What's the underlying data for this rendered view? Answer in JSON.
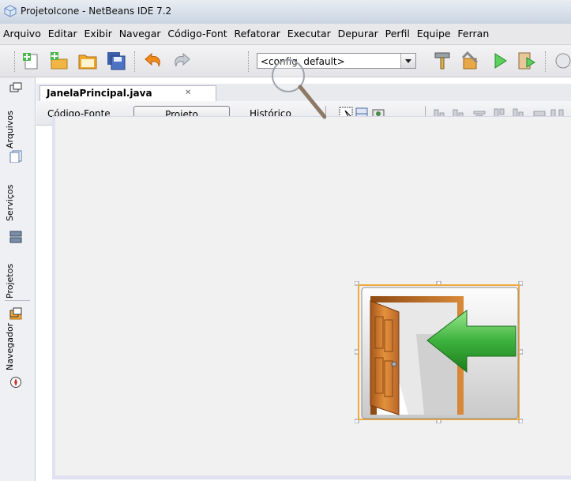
{
  "window": {
    "title": "ProjetoIcone - NetBeans IDE 7.2"
  },
  "menu": [
    "Arquivo",
    "Editar",
    "Exibir",
    "Navegar",
    "Código-Font",
    "Refatorar",
    "Executar",
    "Depurar",
    "Perfil",
    "Equipe",
    "Ferran"
  ],
  "toolbar": {
    "config_value": "<config. default>",
    "icons": [
      "new-file-icon",
      "new-project-icon",
      "open-project-icon",
      "save-all-icon",
      "undo-icon",
      "redo-icon",
      "clean-build-icon",
      "build-icon",
      "run-icon",
      "debug-icon"
    ]
  },
  "side_panels": [
    "Arquivos",
    "Serviços",
    "Projetos",
    "Navegador"
  ],
  "editor": {
    "file_tab": "JanelaPrincipal.java",
    "close_glyph": "✕",
    "view_tabs": [
      "Código-Fonte",
      "Projeto",
      "Histórico"
    ],
    "active_view": "Projeto"
  },
  "design": {
    "component_icon": "exit-door-arrow-icon",
    "colors": {
      "selection": "#f0a93a",
      "arrow": "#3cb13c",
      "door": "#c56e1f"
    }
  }
}
